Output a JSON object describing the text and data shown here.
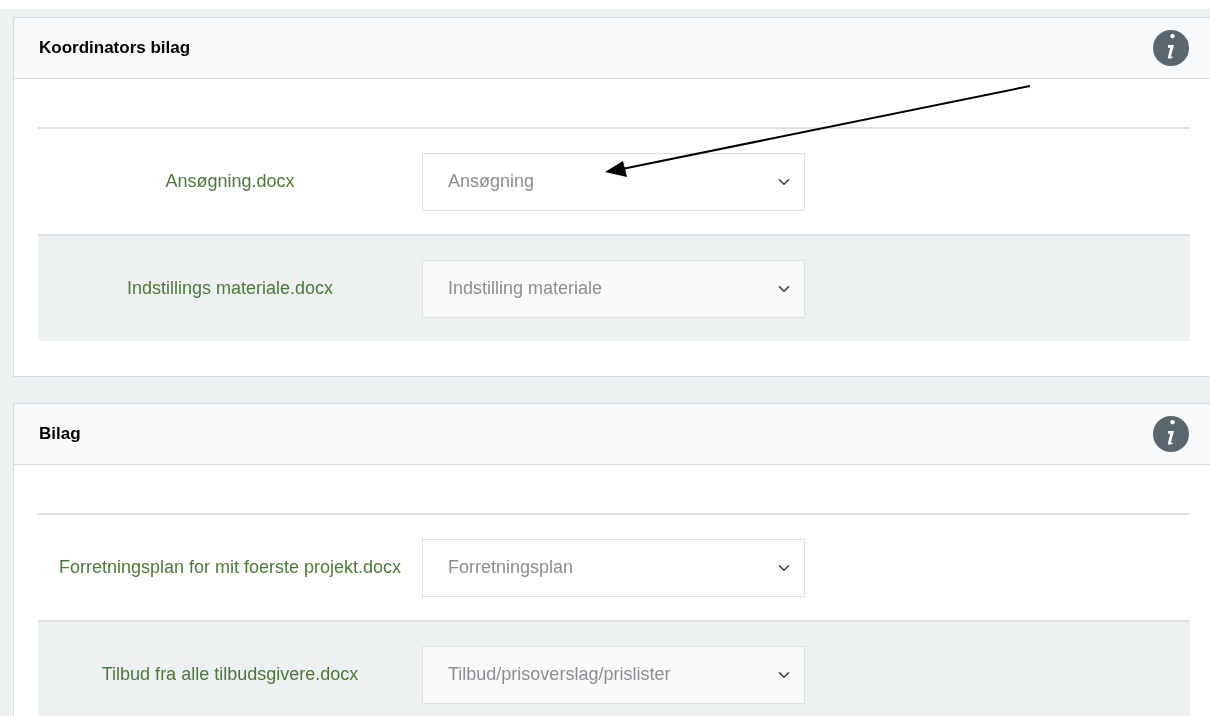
{
  "sections": [
    {
      "title": "Koordinators bilag",
      "rows": [
        {
          "file": "Ansøgning.docx",
          "value": "Ansøgning"
        },
        {
          "file": "Indstillings materiale.docx",
          "value": "Indstilling materiale"
        }
      ]
    },
    {
      "title": "Bilag",
      "rows": [
        {
          "file": "Forretningsplan for mit foerste projekt.docx",
          "value": "Forretningsplan"
        },
        {
          "file": "Tilbud fra alle tilbudsgivere.docx",
          "value": "Tilbud/prisoverslag/prislister"
        }
      ]
    }
  ]
}
